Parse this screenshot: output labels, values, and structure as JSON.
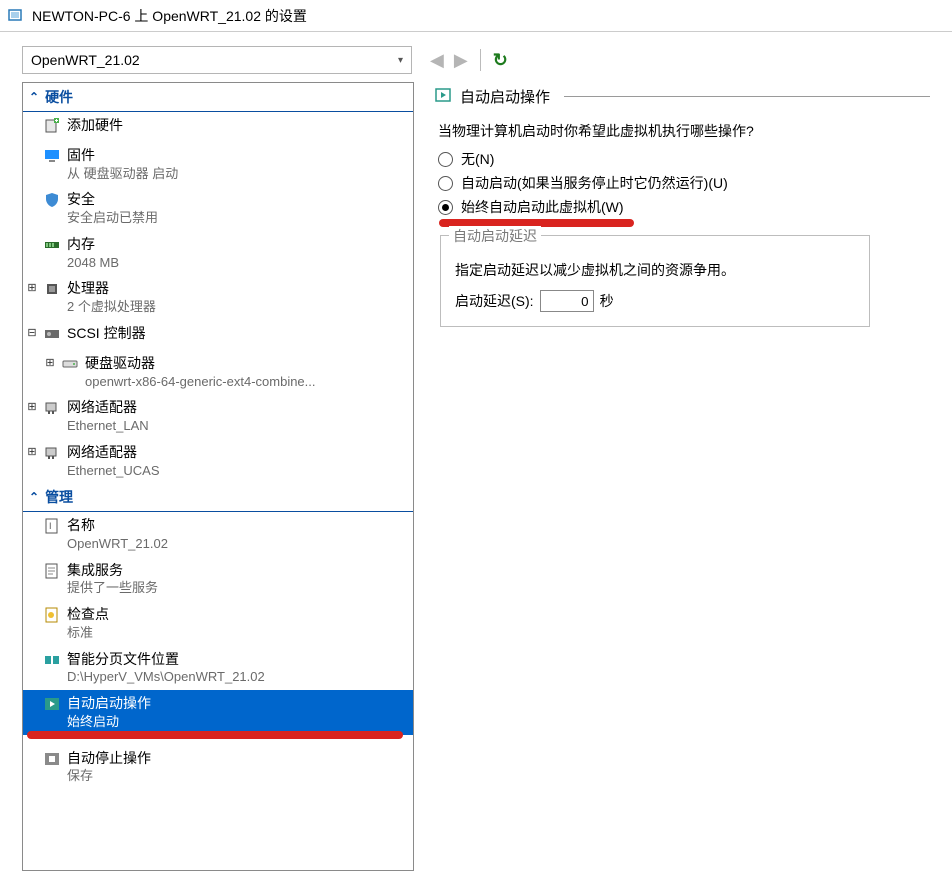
{
  "window": {
    "title": "NEWTON-PC-6 上 OpenWRT_21.02 的设置"
  },
  "toolbar": {
    "vm_name": "OpenWRT_21.02"
  },
  "sections": {
    "hardware": "硬件",
    "management": "管理"
  },
  "hardware": {
    "add_hw": "添加硬件",
    "firmware": {
      "label": "固件",
      "sub": "从 硬盘驱动器 启动"
    },
    "security": {
      "label": "安全",
      "sub": "安全启动已禁用"
    },
    "memory": {
      "label": "内存",
      "sub": "2048 MB"
    },
    "cpu": {
      "label": "处理器",
      "sub": "2 个虚拟处理器"
    },
    "scsi": {
      "label": "SCSI 控制器"
    },
    "hdd": {
      "label": "硬盘驱动器",
      "sub": "openwrt-x86-64-generic-ext4-combine..."
    },
    "nic1": {
      "label": "网络适配器",
      "sub": "Ethernet_LAN"
    },
    "nic2": {
      "label": "网络适配器",
      "sub": "Ethernet_UCAS"
    }
  },
  "management": {
    "name": {
      "label": "名称",
      "sub": "OpenWRT_21.02"
    },
    "services": {
      "label": "集成服务",
      "sub": "提供了一些服务"
    },
    "checkpoint": {
      "label": "检查点",
      "sub": "标准"
    },
    "paging": {
      "label": "智能分页文件位置",
      "sub": "D:\\HyperV_VMs\\OpenWRT_21.02"
    },
    "autostart": {
      "label": "自动启动操作",
      "sub": "始终启动"
    },
    "autostop": {
      "label": "自动停止操作",
      "sub": "保存"
    }
  },
  "right": {
    "heading": "自动启动操作",
    "question": "当物理计算机启动时你希望此虚拟机执行哪些操作?",
    "opt_none": "无(N)",
    "opt_auto": "自动启动(如果当服务停止时它仍然运行)(U)",
    "opt_always": "始终自动启动此虚拟机(W)",
    "group_label": "自动启动延迟",
    "group_desc": "指定启动延迟以减少虚拟机之间的资源争用。",
    "delay_label": "启动延迟(S):",
    "delay_value": "0",
    "delay_unit": "秒"
  }
}
